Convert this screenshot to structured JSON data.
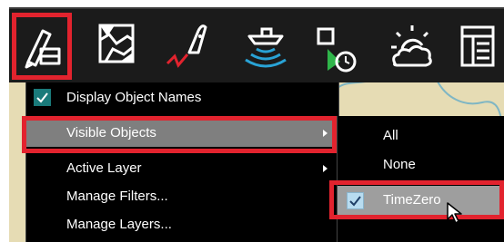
{
  "toolbar": {
    "buttons": [
      {
        "name": "draw-tool",
        "icon": "pencil-eraser-icon",
        "selected": true
      },
      {
        "name": "chart-tool",
        "icon": "chart-map-icon"
      },
      {
        "name": "route-tool",
        "icon": "boat-route-icon"
      },
      {
        "name": "sonar-tool",
        "icon": "sonar-boat-icon"
      },
      {
        "name": "objects-tool",
        "icon": "objects-select-icon"
      },
      {
        "name": "weather-tool",
        "icon": "weather-sun-cloud-icon"
      },
      {
        "name": "report-tool",
        "icon": "report-table-icon"
      }
    ],
    "highlight_color": "#e2232e"
  },
  "menu": {
    "items": [
      {
        "label": "Display Object Names",
        "checked": true
      },
      {
        "label": "Visible Objects",
        "has_submenu": true,
        "hovered": true
      },
      {
        "label": "Active Layer",
        "has_submenu": true
      },
      {
        "label": "Manage Filters..."
      },
      {
        "label": "Manage Layers..."
      }
    ]
  },
  "submenu": {
    "items": [
      {
        "label": "All"
      },
      {
        "label": "None"
      },
      {
        "label": "TimeZero",
        "checked": true,
        "hovered": true
      }
    ]
  },
  "colors": {
    "toolbar_bg": "#1b1b1b",
    "menu_bg": "#000000",
    "hover_bg": "#7f7f7f",
    "check_bg": "#1a7a7a",
    "accent_cyan": "#29a3d6",
    "accent_red": "#e2232e",
    "accent_green": "#2fb54a",
    "chart_bg": "#e6dcb4"
  }
}
